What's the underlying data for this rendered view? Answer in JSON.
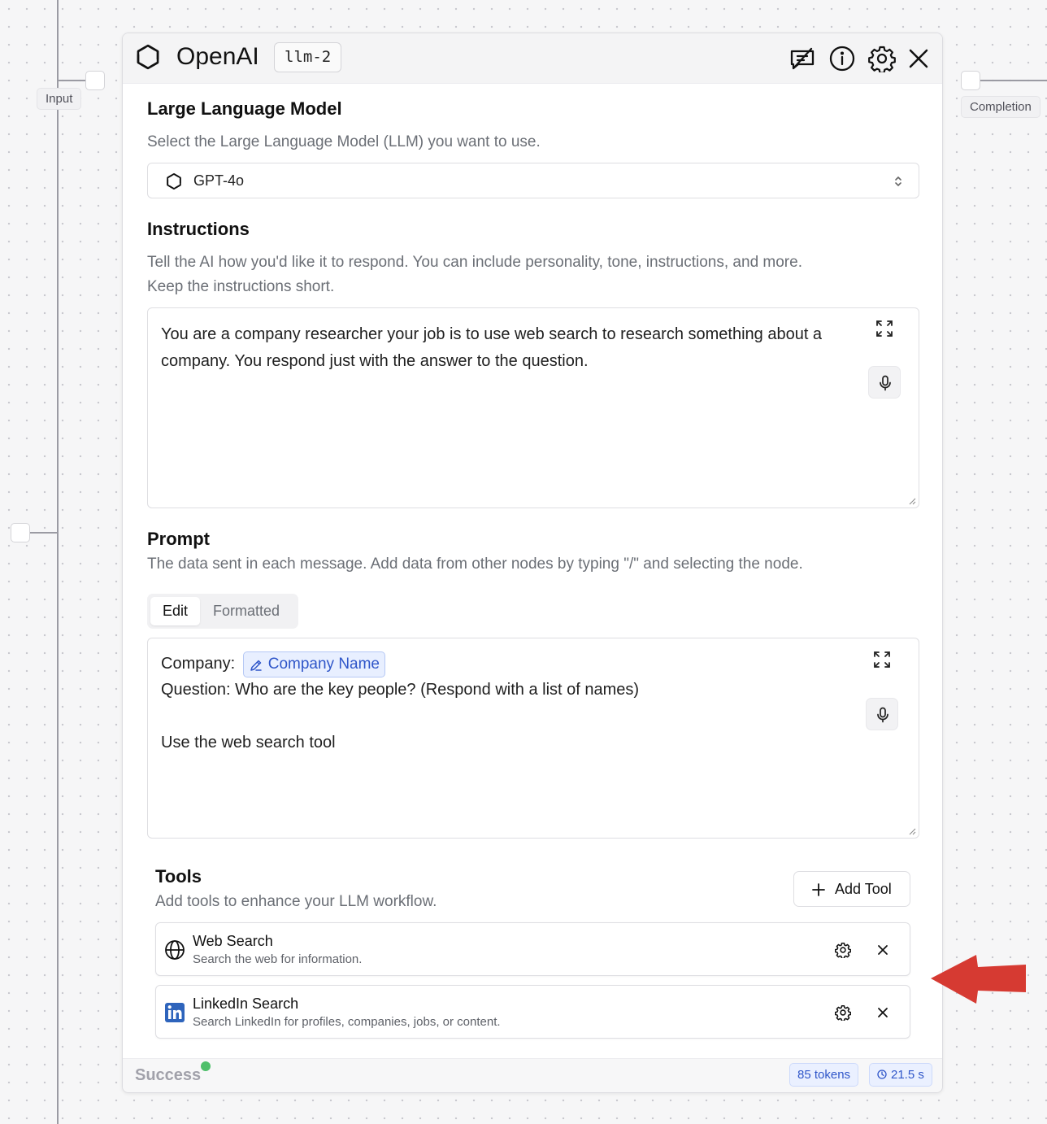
{
  "canvas": {
    "input_label": "Input",
    "completion_label": "Completion"
  },
  "node": {
    "title": "OpenAI",
    "id": "llm-2",
    "header_icons": [
      "chat-slash-icon",
      "info-icon",
      "gear-icon",
      "close-icon"
    ]
  },
  "llm": {
    "title": "Large Language Model",
    "description": "Select the Large Language Model (LLM) you want to use.",
    "selected_model": "GPT-4o"
  },
  "instructions": {
    "title": "Instructions",
    "description_line1": "Tell the AI how you'd like it to respond. You can include personality, tone, instructions, and more.",
    "description_line2": "Keep the instructions short.",
    "text": "You are a company researcher your job is to use web search to research something about a company. You respond just with the answer to the question."
  },
  "prompt": {
    "title": "Prompt",
    "description": "The data sent in each message. Add data from other nodes by typing \"/\" and selecting the node.",
    "tabs": [
      {
        "label": "Edit",
        "active": true
      },
      {
        "label": "Formatted",
        "active": false
      }
    ],
    "company_prefix": "Company:",
    "company_variable": "Company Name",
    "question_line": "Question: Who are the key people? (Respond with a list of names)",
    "tool_line": "Use the web search tool"
  },
  "tools": {
    "title": "Tools",
    "description": "Add tools to enhance your LLM workflow.",
    "add_label": "Add Tool",
    "items": [
      {
        "name": "Web Search",
        "description": "Search the web for information.",
        "icon": "globe-icon"
      },
      {
        "name": "LinkedIn Search",
        "description": "Search LinkedIn for profiles, companies, jobs, or content.",
        "icon": "linkedin-icon"
      }
    ]
  },
  "footer": {
    "status": "Success",
    "tokens": "85 tokens",
    "duration": "21.5 s"
  },
  "colors": {
    "accent_blue": "#2f56c9",
    "success_green": "#4ebf6a",
    "annotation_red": "#d63a32"
  }
}
